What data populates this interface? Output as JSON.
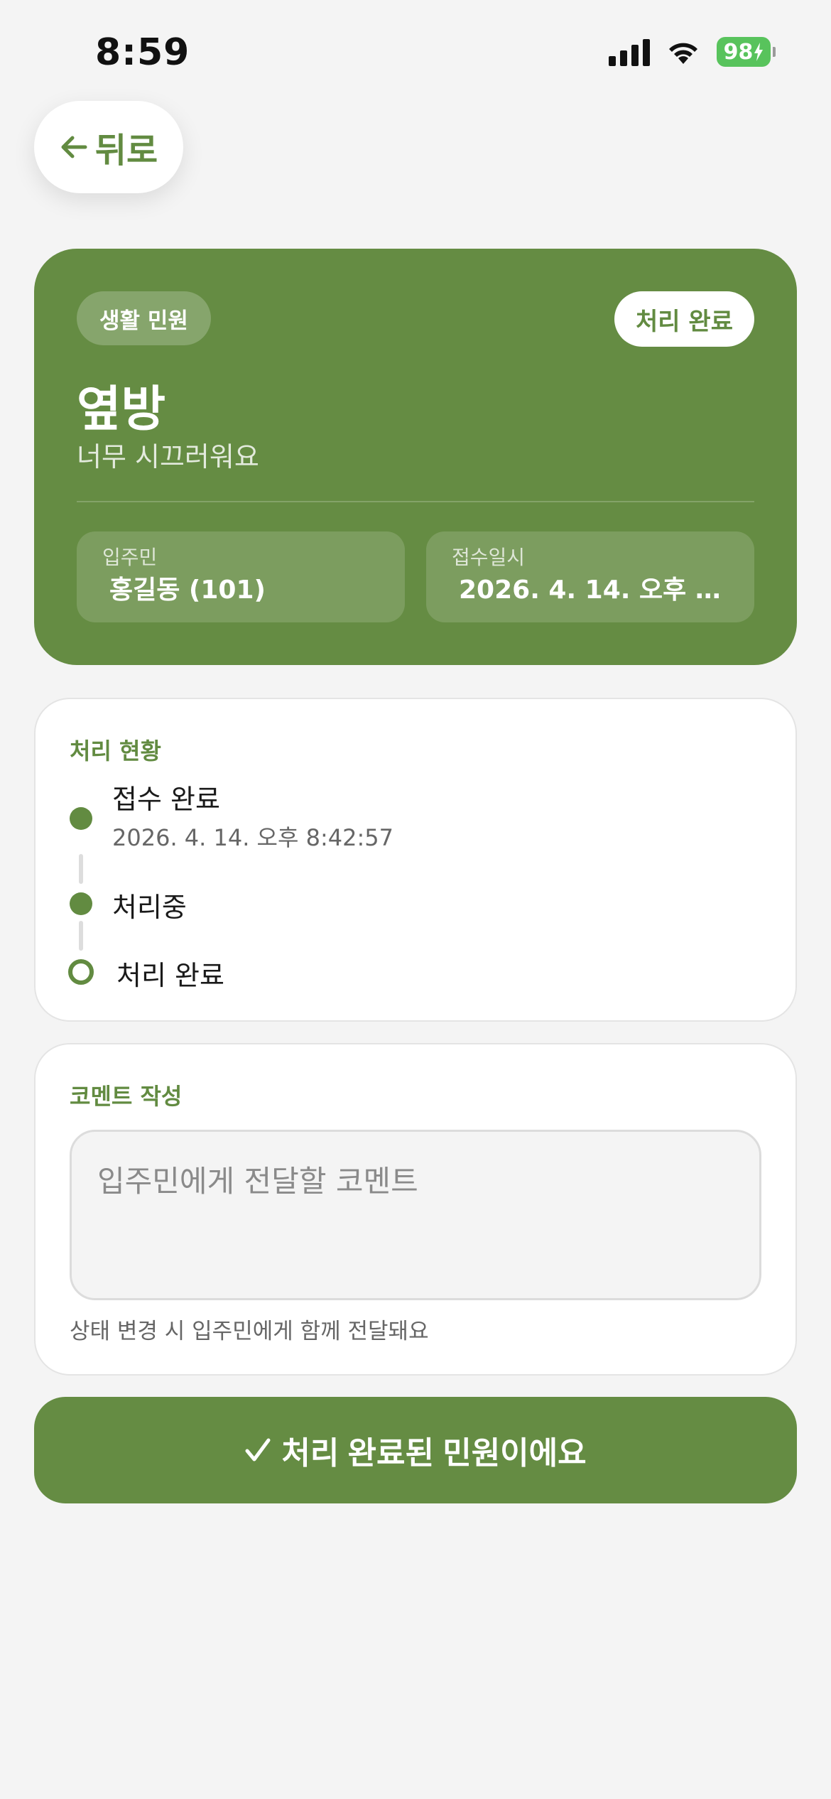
{
  "status_bar": {
    "time": "8:59",
    "battery": "98"
  },
  "nav": {
    "back_label": "뒤로"
  },
  "complaint": {
    "category": "생활 민원",
    "status": "처리 완료",
    "title": "옆방",
    "description": "너무 시끄러워요",
    "resident_label": "입주민",
    "resident_value": "홍길동 (101)",
    "received_label": "접수일시",
    "received_value": "2026. 4. 14. 오후 8:..."
  },
  "progress": {
    "title": "처리 현황",
    "steps": [
      {
        "label": "접수 완료",
        "time": "2026. 4. 14. 오후 8:42:57"
      },
      {
        "label": "처리중"
      },
      {
        "label": "처리 완료"
      }
    ]
  },
  "comment": {
    "title": "코멘트 작성",
    "placeholder": "입주민에게 전달할 코멘트",
    "hint": "상태 변경 시 입주민에게 함께 전달돼요"
  },
  "action": {
    "button_label": "처리 완료된 민원이에요"
  },
  "colors": {
    "brand_green": "#658c43",
    "accent_text": "#628b41",
    "background": "#f4f4f4",
    "battery_green": "#58c35c"
  }
}
